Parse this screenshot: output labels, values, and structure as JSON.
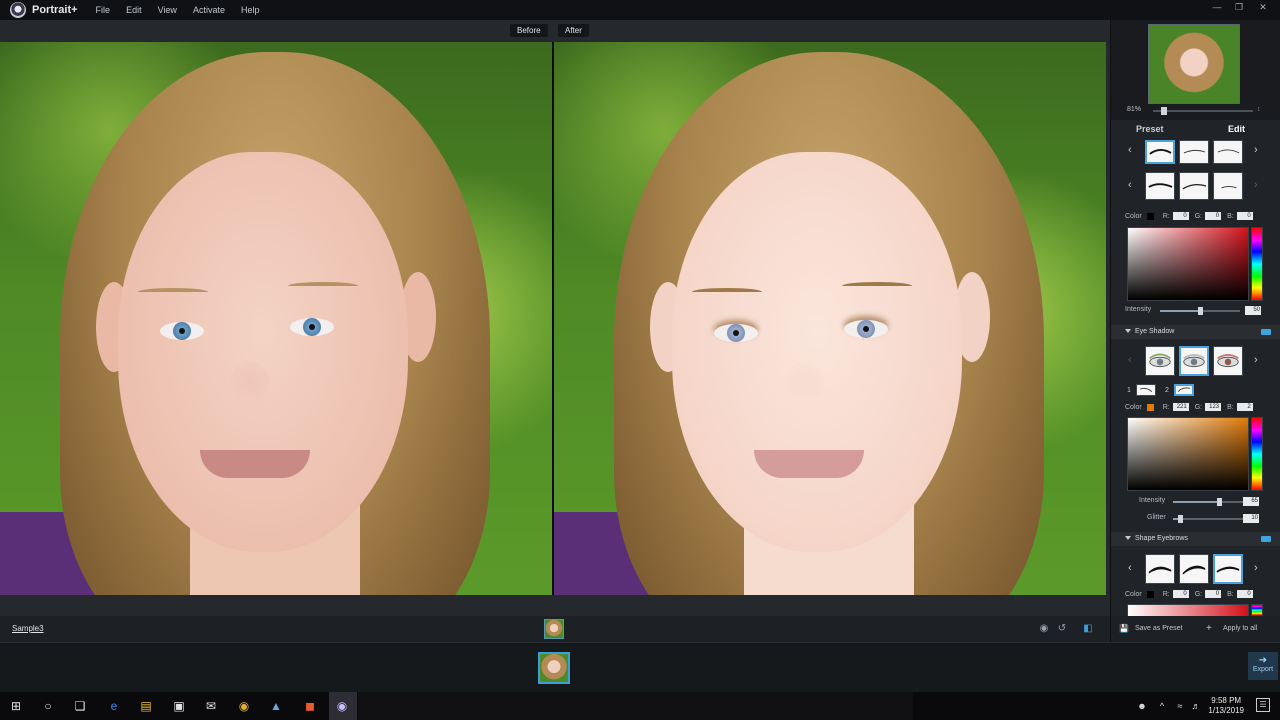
{
  "app": {
    "name": "Portrait+"
  },
  "menu": [
    "File",
    "Edit",
    "View",
    "Activate",
    "Help"
  ],
  "views": {
    "before": "Before",
    "after": "After"
  },
  "status": {
    "sample_name": "Sample3"
  },
  "navigator": {
    "zoom": "81%"
  },
  "panel_tabs": {
    "preset": "Preset",
    "edit": "Edit"
  },
  "eyebrow_color": {
    "label": "Color",
    "r_label": "R:",
    "g_label": "G:",
    "b_label": "B:",
    "r": "0",
    "g": "0",
    "b": "0",
    "hex": "#000000"
  },
  "eyebrow_intensity": {
    "label": "Intensity",
    "value": "50"
  },
  "eye_shadow": {
    "title": "Eye Shadow",
    "layer1": "1",
    "layer2": "2",
    "color": {
      "label": "Color",
      "r_label": "R:",
      "g_label": "G:",
      "b_label": "B:",
      "r": "221",
      "g": "123",
      "b": "2",
      "hex": "#dd7b02"
    },
    "intensity": {
      "label": "Intensity",
      "value": "65"
    },
    "glitter": {
      "label": "Glitter",
      "value": "10"
    }
  },
  "shape_eyebrows": {
    "title": "Shape Eyebrows",
    "color": {
      "label": "Color",
      "r_label": "R:",
      "g_label": "G:",
      "b_label": "B:",
      "r": "0",
      "g": "0",
      "b": "0",
      "hex": "#000000"
    }
  },
  "footer": {
    "save_preset": "Save as Preset",
    "apply_all": "Apply to all",
    "export": "Export"
  },
  "taskbar": {
    "time": "9:58 PM",
    "date": "1/13/2019"
  },
  "colors": {
    "accent": "#3ba0d8",
    "panel": "#202327"
  }
}
